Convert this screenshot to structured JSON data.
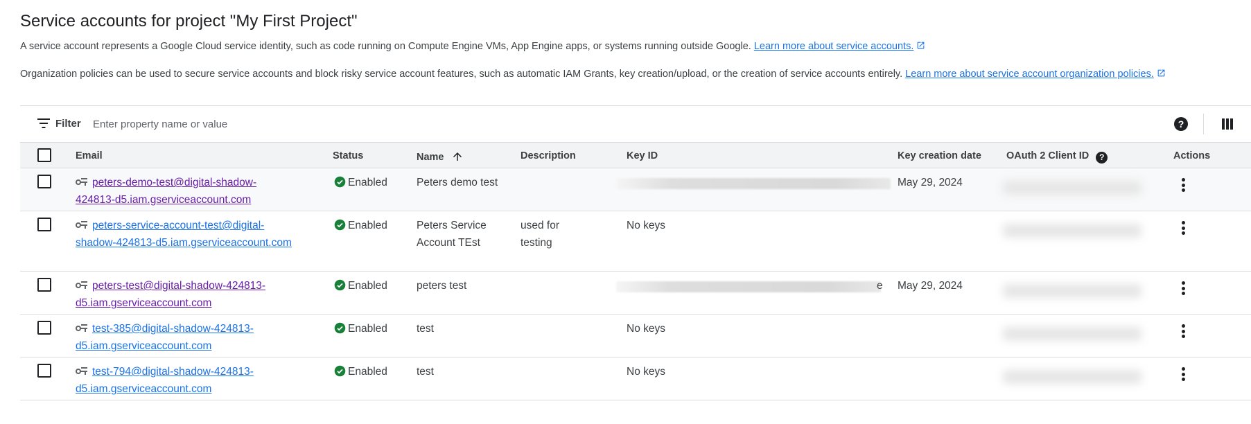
{
  "page": {
    "title": "Service accounts for project \"My First Project\"",
    "intro_text": "A service account represents a Google Cloud service identity, such as code running on Compute Engine VMs, App Engine apps, or systems running outside Google.",
    "intro_link": "Learn more about service accounts.",
    "policy_text": "Organization policies can be used to secure service accounts and block risky service account features, such as automatic IAM Grants, key creation/upload, or the creation of service accounts entirely.",
    "policy_link": "Learn more about service account organization policies."
  },
  "filter": {
    "label": "Filter",
    "placeholder": "Enter property name or value",
    "help_icon": "help-circle-icon",
    "columns_icon": "column-display-icon"
  },
  "table": {
    "columns": {
      "email": "Email",
      "status": "Status",
      "name": "Name",
      "description": "Description",
      "key_id": "Key ID",
      "key_creation_date": "Key creation date",
      "oauth_client_id": "OAuth 2 Client ID",
      "actions": "Actions"
    },
    "sort": {
      "column": "Name",
      "direction": "ascending"
    },
    "rows": [
      {
        "email_line1": "peters-demo-test@digital-shadow-",
        "email_line2": "424813-d5.iam.gserviceaccount.com",
        "status": "Enabled",
        "name": "Peters demo test",
        "description": "",
        "key_id": "",
        "key_date": "May 29, 2024",
        "visited": true
      },
      {
        "email_line1": "peters-service-account-test@digital-",
        "email_line2": "shadow-424813-d5.iam.gserviceaccount.com",
        "status": "Enabled",
        "name": "Peters Service Account TEst",
        "description": "used for testing",
        "key_id": "No keys",
        "key_date": "",
        "visited": false
      },
      {
        "email_line1": "peters-test@digital-shadow-424813-",
        "email_line2": "d5.iam.gserviceaccount.com",
        "status": "Enabled",
        "name": "peters test",
        "description": "",
        "key_id": "e",
        "key_date": "May 29, 2024",
        "visited": true
      },
      {
        "email_line1": "test-385@digital-shadow-424813-",
        "email_line2": "d5.iam.gserviceaccount.com",
        "status": "Enabled",
        "name": "test",
        "description": "",
        "key_id": "No keys",
        "key_date": "",
        "visited": false
      },
      {
        "email_line1": "test-794@digital-shadow-424813-",
        "email_line2": "d5.iam.gserviceaccount.com",
        "status": "Enabled",
        "name": "test",
        "description": "",
        "key_id": "No keys",
        "key_date": "",
        "visited": false
      }
    ]
  },
  "colors": {
    "link": "#1a73e8",
    "visited_link": "#681da8",
    "enabled_status": "#188038",
    "header_bg": "#f1f3f4"
  }
}
